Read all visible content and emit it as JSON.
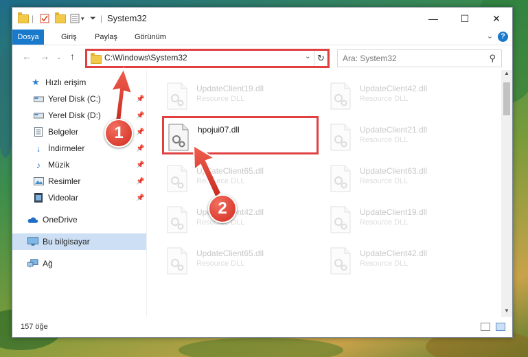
{
  "window": {
    "title": "System32",
    "controls": {
      "minimize": "—",
      "maximize": "☐",
      "close": "✕"
    }
  },
  "ribbon": {
    "tabs": [
      "Dosya",
      "Giriş",
      "Paylaş",
      "Görünüm"
    ],
    "help": "?"
  },
  "address": {
    "path": "C:\\Windows\\System32",
    "search_placeholder": "Ara: System32"
  },
  "sidebar": {
    "items": [
      {
        "label": "Hızlı erişim",
        "icon": "star-icon"
      },
      {
        "label": "Yerel Disk (C:)",
        "icon": "drive-icon",
        "pinned": true
      },
      {
        "label": "Yerel Disk (D:)",
        "icon": "drive-icon",
        "pinned": true
      },
      {
        "label": "Belgeler",
        "icon": "documents-icon",
        "pinned": true
      },
      {
        "label": "İndirmeler",
        "icon": "downloads-icon",
        "pinned": true
      },
      {
        "label": "Müzik",
        "icon": "music-icon",
        "pinned": true
      },
      {
        "label": "Resimler",
        "icon": "pictures-icon",
        "pinned": true
      },
      {
        "label": "Videolar",
        "icon": "videos-icon",
        "pinned": true
      },
      {
        "label": "OneDrive",
        "icon": "cloud-icon"
      },
      {
        "label": "Bu bilgisayar",
        "icon": "computer-icon",
        "selected": true
      },
      {
        "label": "Ağ",
        "icon": "network-icon"
      }
    ]
  },
  "files": {
    "highlighted": {
      "name": "hpojui07.dll",
      "type": ""
    },
    "left_column": [
      {
        "name": "UpdateClient19.dll",
        "type": "Resource DLL"
      },
      {
        "name": "UpdateClient65.dll",
        "type": "Resource DLL"
      },
      {
        "name": "UpdateClient42.dll",
        "type": "Resource DLL"
      },
      {
        "name": "UpdateClient65.dll",
        "type": "Resource DLL"
      }
    ],
    "right_column": [
      {
        "name": "UpdateClient42.dll",
        "type": "Resource DLL"
      },
      {
        "name": "UpdateClient21.dll",
        "type": "Resource DLL"
      },
      {
        "name": "UpdateClient63.dll",
        "type": "Resource DLL"
      },
      {
        "name": "UpdateClient19.dll",
        "type": "Resource DLL"
      },
      {
        "name": "UpdateClient42.dll",
        "type": "Resource DLL"
      }
    ]
  },
  "status": {
    "count": "157 öğe"
  },
  "annotations": {
    "step1": "1",
    "step2": "2",
    "color": "#e04040"
  }
}
